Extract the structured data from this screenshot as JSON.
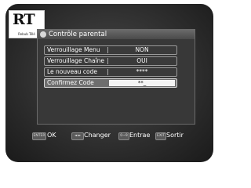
{
  "logo": {
    "mark": "RT",
    "subtitle": "Rebub Télé"
  },
  "panel": {
    "title": "Contrôle parental"
  },
  "rows": [
    {
      "label": "Verrouillage Menu",
      "value": "NON"
    },
    {
      "label": "Verrouillage Chaîne",
      "value": "OUI"
    },
    {
      "label": "Le nouveau code",
      "value": "****"
    },
    {
      "label": "Confirmez Code",
      "value": "**_"
    }
  ],
  "footer": {
    "ok_key": "ENTER",
    "ok_label": "OK",
    "change_key": "◄ ►",
    "change_label": "Changer",
    "digits_key": "0~9",
    "digits_label": "Entrae",
    "exit_key": "EXIT",
    "exit_label": "Sortir"
  }
}
